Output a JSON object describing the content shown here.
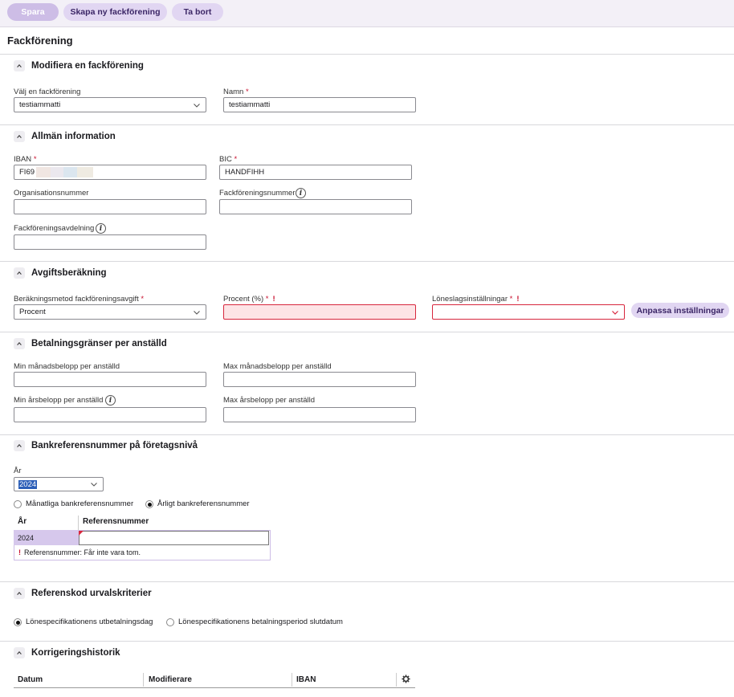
{
  "toolbar": {
    "save_label": "Spara",
    "create_label": "Skapa ny fackförening",
    "delete_label": "Ta bort"
  },
  "page_title": "Fackförening",
  "modify": {
    "title": "Modifiera en fackförening",
    "choose_label": "Välj en fackförening",
    "choose_value": "testiammatti",
    "name_label": "Namn",
    "name_value": "testiammatti"
  },
  "general": {
    "title": "Allmän information",
    "iban_label": "IBAN",
    "iban_value": "FI69",
    "bic_label": "BIC",
    "bic_value": "HANDFIHH",
    "org_label": "Organisationsnummer",
    "union_no_label": "Fackföreningsnummer",
    "division_label": "Fackföreningsavdelning"
  },
  "fee": {
    "title": "Avgiftsberäkning",
    "method_label": "Beräkningsmetod fackföreningsavgift",
    "method_value": "Procent",
    "percent_label": "Procent (%)",
    "salary_label": "Löneslagsinställningar",
    "customize_label": "Anpassa inställningar"
  },
  "limits": {
    "title": "Betalningsgränser per anställd",
    "min_month_label": "Min månadsbelopp per anställd",
    "max_month_label": "Max månadsbelopp per anställd",
    "min_year_label": "Min årsbelopp per anställd",
    "max_year_label": "Max årsbelopp per anställd"
  },
  "bankref": {
    "title": "Bankreferensnummer på företagsnivå",
    "year_label": "År",
    "year_value": "2024",
    "monthly_label": "Månatliga bankreferensnummer",
    "yearly_label": "Årligt bankreferensnummer",
    "col_year": "År",
    "col_ref": "Referensnummer",
    "row_year": "2024",
    "error_text": "Referensnummer: Får inte vara tom.",
    "error_mark": "!"
  },
  "refcode": {
    "title": "Referenskod urvalskriterier",
    "opt1": "Lönespecifikationens utbetalningsdag",
    "opt2": "Lönespecifikationens betalningsperiod slutdatum"
  },
  "history": {
    "title": "Korrigeringshistorik",
    "col_date": "Datum",
    "col_modifier": "Modifierare",
    "col_iban": "IBAN"
  },
  "required_mark": "*",
  "error_mark": "!",
  "info_glyph": "i",
  "colors": {
    "accent": "#e1d6f2",
    "accent_text": "#3b2666",
    "error": "#d7263d",
    "error_bg": "#fde4e6"
  }
}
